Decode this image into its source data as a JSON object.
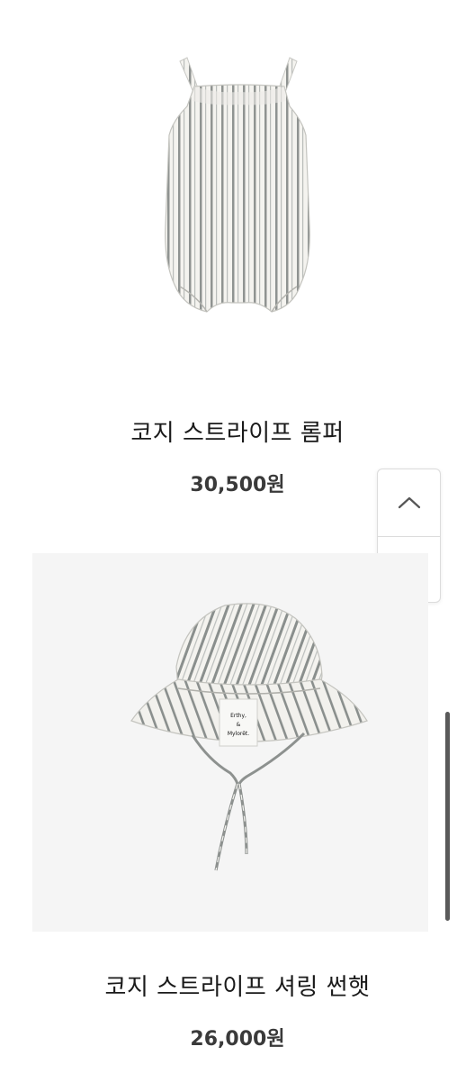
{
  "products": [
    {
      "name": "코지 스트라이프 롬퍼",
      "price": "30,500원",
      "image_icon": "striped-romper-image"
    },
    {
      "name": "코지 스트라이프 셔링 썬햇",
      "price": "26,000원",
      "image_icon": "striped-sunhat-image",
      "label_text": "Erthy, & Mylorêt."
    }
  ],
  "scroll_buttons": {
    "up_icon": "chevron-up-icon",
    "down_icon": "chevron-down-icon"
  },
  "colors": {
    "stripe": "#8a8f8d",
    "fabric": "#f4f3ef",
    "text": "#1a1a1a",
    "price": "#3a3a3a"
  }
}
